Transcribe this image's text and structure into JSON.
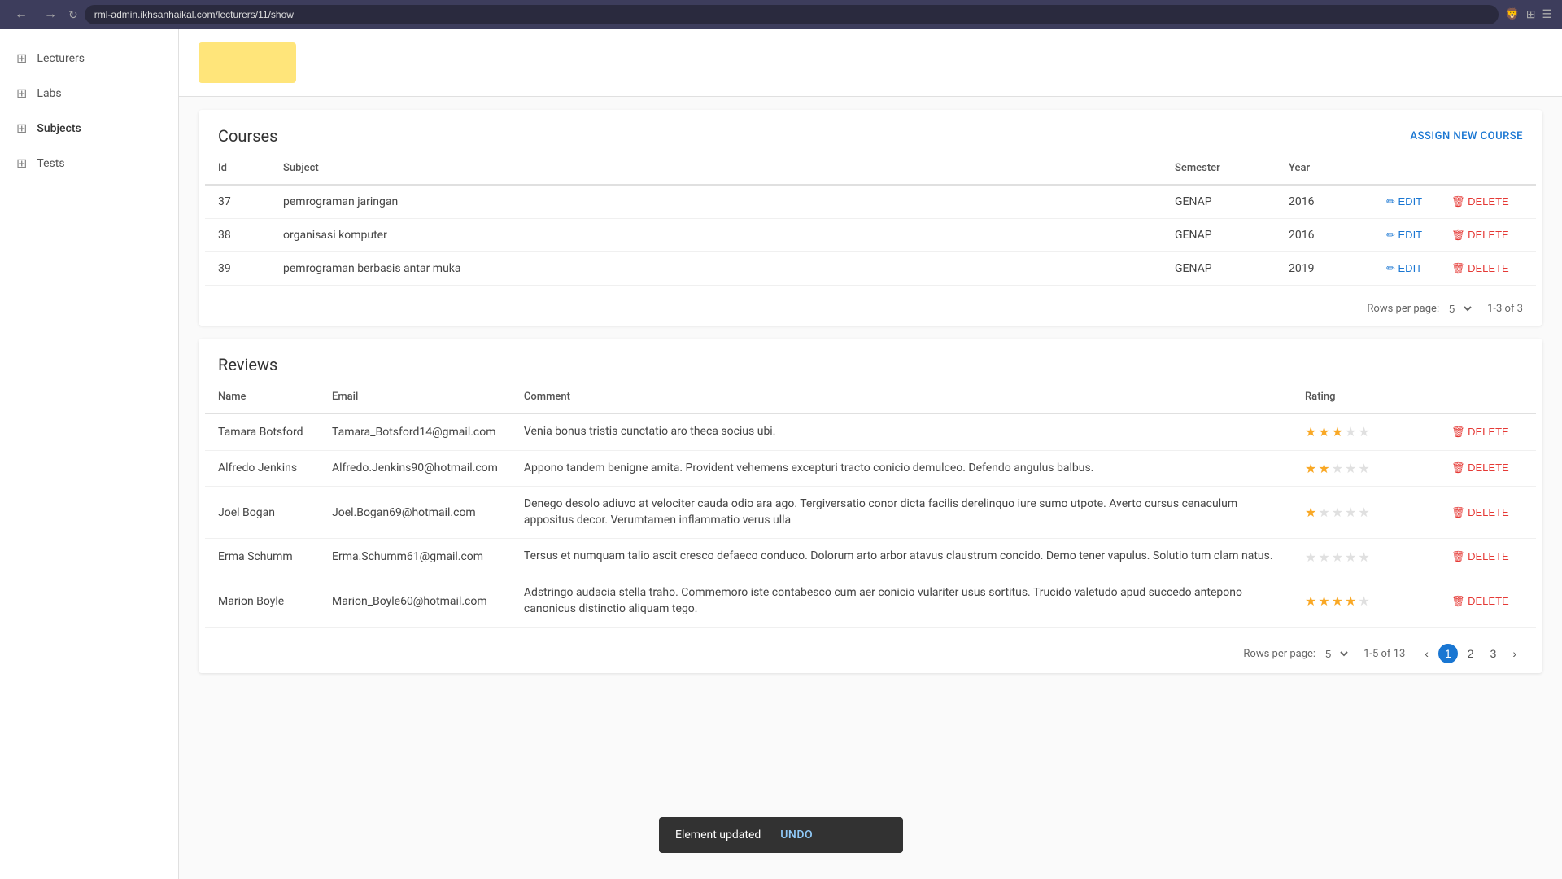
{
  "browser": {
    "url": "rml-admin.ikhsanhaikal.com/lecturers/11/show",
    "back_disabled": false,
    "forward_disabled": false
  },
  "sidebar": {
    "items": [
      {
        "id": "lecturers",
        "label": "Lecturers",
        "icon": "⊞"
      },
      {
        "id": "labs",
        "label": "Labs",
        "icon": "⊞"
      },
      {
        "id": "subjects",
        "label": "Subjects",
        "icon": "⊞",
        "active": true
      },
      {
        "id": "tests",
        "label": "Tests",
        "icon": "⊞"
      }
    ]
  },
  "courses": {
    "title": "Courses",
    "assign_label": "ASSIGN NEW COURSE",
    "columns": [
      "Id",
      "Subject",
      "Semester",
      "Year"
    ],
    "rows": [
      {
        "id": "37",
        "subject": "pemrograman jaringan",
        "semester": "GENAP",
        "year": "2016"
      },
      {
        "id": "38",
        "subject": "organisasi komputer",
        "semester": "GENAP",
        "year": "2016"
      },
      {
        "id": "39",
        "subject": "pemrograman berbasis antar muka",
        "semester": "GENAP",
        "year": "2019"
      }
    ],
    "pagination": {
      "rows_per_page_label": "Rows per page:",
      "rows_per_page_value": "5",
      "range": "1-3 of 3"
    },
    "edit_label": "EDIT",
    "delete_label": "DELETE"
  },
  "reviews": {
    "title": "Reviews",
    "columns": [
      "Name",
      "Email",
      "Comment",
      "Rating"
    ],
    "rows": [
      {
        "name": "Tamara Botsford",
        "email": "Tamara_Botsford14@gmail.com",
        "comment": "Venia bonus tristis cunctatio aro theca socius ubi.",
        "rating": 3
      },
      {
        "name": "Alfredo Jenkins",
        "email": "Alfredo.Jenkins90@hotmail.com",
        "comment": "Appono tandem benigne amita. Provident vehemens excepturi tracto conicio demulceo. Defendo angulus balbus.",
        "rating": 2
      },
      {
        "name": "Joel Bogan",
        "email": "Joel.Bogan69@hotmail.com",
        "comment": "Denego desolo adiuvo at velociter cauda odio ara ago. Tergiversatio conor dicta facilis derelinquo iure sumo utpote. Averto cursus cenaculum appositus decor. Verumtamen inflammatio verus ulla",
        "rating": 1
      },
      {
        "name": "Erma Schumm",
        "email": "Erma.Schumm61@gmail.com",
        "comment": "Tersus et numquam talio ascit cresco defaeco conduco. Dolorum arto arbor atavus claustrum concido. Demo tener vapulus. Solutio tum clam natus.",
        "rating": 0
      },
      {
        "name": "Marion Boyle",
        "email": "Marion_Boyle60@hotmail.com",
        "comment": "Adstringo audacia stella traho. Commemoro iste contabesco cum aer conicio vulariter usus sortitus. Trucido valetudo apud succedo antepono canonicus distinctio aliquam tego.",
        "rating": 4
      }
    ],
    "pagination": {
      "rows_per_page_label": "Rows per page:",
      "rows_per_page_value": "5",
      "range": "1-5 of 13",
      "pages": [
        "1",
        "2",
        "3"
      ]
    },
    "delete_label": "DELETE"
  },
  "toast": {
    "message": "Element updated",
    "undo_label": "UNDO"
  }
}
